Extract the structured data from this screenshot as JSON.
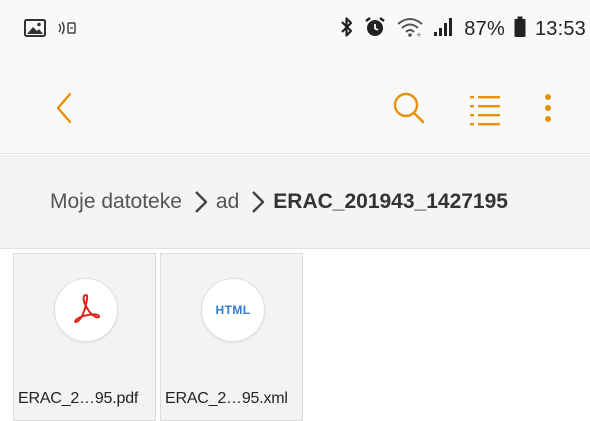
{
  "status_bar": {
    "battery_percent": "87%",
    "time": "13:53",
    "icons": [
      "image-icon",
      "nfc-icon",
      "bluetooth-icon",
      "alarm-icon",
      "wifi-icon",
      "signal-icon",
      "battery-icon"
    ]
  },
  "app_bar": {
    "icons": [
      "back-icon",
      "search-icon",
      "list-view-icon",
      "more-options-icon"
    ],
    "accent_color": "#e8920c"
  },
  "breadcrumb": {
    "items": [
      {
        "label": "Moje datoteke"
      },
      {
        "label": "ad"
      },
      {
        "label": "ERAC_201943_1427195"
      }
    ]
  },
  "files": [
    {
      "name": "ERAC_2…95.pdf",
      "icon": "pdf-icon",
      "icon_color": "#e2231a"
    },
    {
      "name": "ERAC_2…95.xml",
      "icon": "html-file-icon",
      "icon_label": "HTML",
      "icon_color": "#2f7fd0"
    }
  ]
}
